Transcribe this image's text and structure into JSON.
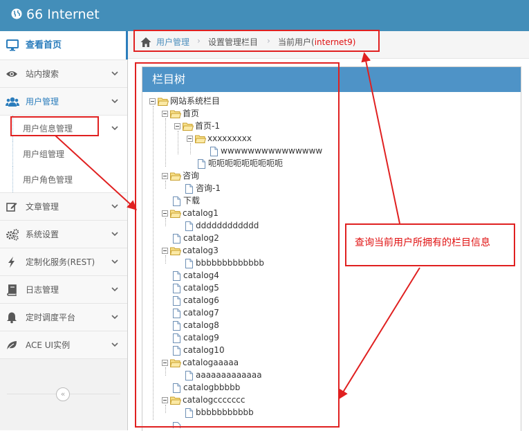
{
  "app": {
    "title": "66 Internet"
  },
  "colors": {
    "brand": "#438eb9",
    "header": "#4e93c7",
    "link": "#2b7dbc",
    "annotation": "#e02020"
  },
  "sidebar": {
    "items": [
      {
        "label": "查看首页",
        "icon": "monitor-icon"
      },
      {
        "label": "站内搜索",
        "icon": "eye-icon"
      },
      {
        "label": "用户管理",
        "icon": "users-icon"
      },
      {
        "label": "文章管理",
        "icon": "edit-icon"
      },
      {
        "label": "系统设置",
        "icon": "gears-icon"
      },
      {
        "label": "定制化服务(REST)",
        "icon": "bolt-icon"
      },
      {
        "label": "日志管理",
        "icon": "book-icon"
      },
      {
        "label": "定时调度平台",
        "icon": "bell-icon"
      },
      {
        "label": "ACE UI实例",
        "icon": "leaf-icon"
      }
    ],
    "submenu": [
      {
        "label": "用户信息管理"
      },
      {
        "label": "用户组管理"
      },
      {
        "label": "用户角色管理"
      }
    ],
    "collapse_glyph": "«"
  },
  "breadcrumb": {
    "items": [
      "用户管理",
      "设置管理栏目",
      "当前用户("
    ],
    "current_user": "internet9",
    "close_paren": ")",
    "separator": "›"
  },
  "widget": {
    "title": "栏目树"
  },
  "tree": {
    "root": "网站系统栏目",
    "nodes": [
      {
        "label": "首页"
      },
      {
        "label": "首页-1"
      },
      {
        "label": "xxxxxxxxx"
      },
      {
        "label": "wwwwwwwwwwwwwww"
      },
      {
        "label": "呃呃呃呃呃呃呃呃呃"
      },
      {
        "label": "咨询"
      },
      {
        "label": "咨询-1"
      },
      {
        "label": "下载"
      },
      {
        "label": "catalog1"
      },
      {
        "label": "dddddddddddd"
      },
      {
        "label": "catalog2"
      },
      {
        "label": "catalog3"
      },
      {
        "label": "bbbbbbbbbbbbb"
      },
      {
        "label": "catalog4"
      },
      {
        "label": "catalog5"
      },
      {
        "label": "catalog6"
      },
      {
        "label": "catalog7"
      },
      {
        "label": "catalog8"
      },
      {
        "label": "catalog9"
      },
      {
        "label": "catalog10"
      },
      {
        "label": "catalogaaaaa"
      },
      {
        "label": "aaaaaaaaaaaaa"
      },
      {
        "label": "catalogbbbbb"
      },
      {
        "label": "catalogccccccc"
      },
      {
        "label": "bbbbbbbbbbb"
      }
    ]
  },
  "annotation": {
    "note": "查询当前用户所拥有的栏目信息"
  }
}
